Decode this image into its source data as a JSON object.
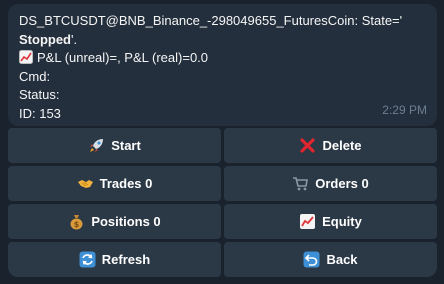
{
  "message": {
    "line1": "DS_BTCUSDT@BNB_Binance_-298049655_FuturesCoin: State='",
    "line2": "Stopped",
    "line2_suffix": "'.",
    "pnl": "P&L (unreal)=, P&L (real)=0.0",
    "cmd": "Cmd:",
    "status": "Status:",
    "id": "ID: 153",
    "time": "2:29 PM",
    "pnl_icon": "chart-increasing-icon"
  },
  "buttons": [
    {
      "label": "Start",
      "icon": "rocket-icon"
    },
    {
      "label": "Delete",
      "icon": "cross-mark-icon"
    },
    {
      "label": "Trades 0",
      "icon": "handshake-icon"
    },
    {
      "label": "Orders 0",
      "icon": "shopping-cart-icon"
    },
    {
      "label": "Positions 0",
      "icon": "money-bag-icon"
    },
    {
      "label": "Equity",
      "icon": "chart-increasing-icon"
    },
    {
      "label": "Refresh",
      "icon": "refresh-arrows-icon"
    },
    {
      "label": "Back",
      "icon": "back-arrow-icon"
    }
  ],
  "colors": {
    "background": "#19222d",
    "bubble": "#242f3d",
    "button": "#2b3846",
    "timestamp": "#6d7f8f"
  }
}
